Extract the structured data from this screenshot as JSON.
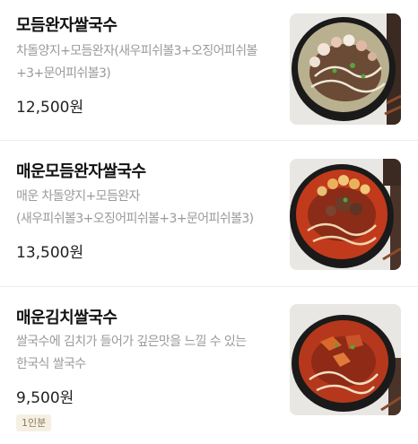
{
  "menu_items": [
    {
      "name": "모듬완자쌀국수",
      "description": "차돌양지+모듬완자(새우피쉬볼3+오징어피쉬볼+3+문어피쉬볼3)",
      "price": "12,500원",
      "image": "clear-broth-pho-with-meatballs",
      "badge": ""
    },
    {
      "name": "매운모듬완자쌀국수",
      "description": "매운 차돌양지+모듬완자(새우피쉬볼3+오징어피쉬볼+3+문어피쉬볼3)",
      "price": "13,500원",
      "image": "spicy-red-pho-with-meatballs",
      "badge": ""
    },
    {
      "name": "매운김치쌀국수",
      "description": "쌀국수에 김치가 들어가 깊은맛을 느낄 수 있는 한국식 쌀국수",
      "price": "9,500원",
      "image": "spicy-kimchi-pho",
      "badge": "1인분"
    }
  ],
  "colors": {
    "name_text": "#111111",
    "description_text": "#9a9a9a",
    "price_text": "#222222",
    "badge_bg": "#f6f0e4",
    "badge_text": "#8a7a5c",
    "divider": "#ececec"
  }
}
